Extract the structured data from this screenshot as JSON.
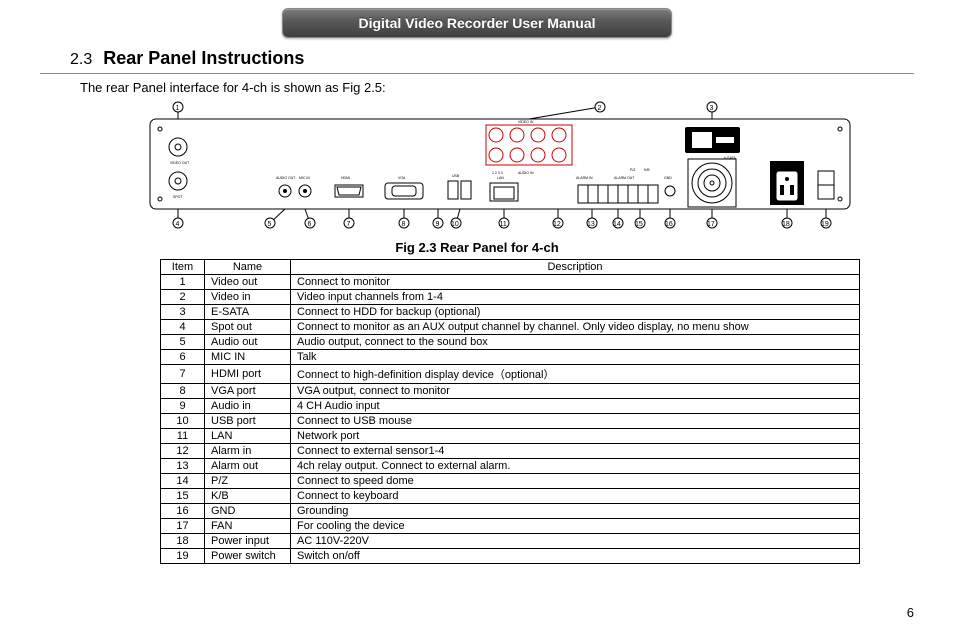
{
  "header": {
    "title": "Digital Video Recorder User Manual"
  },
  "section": {
    "number": "2.3",
    "title": "Rear Panel Instructions",
    "intro": "The rear Panel interface for 4-ch is shown as Fig 2.5:"
  },
  "figure": {
    "caption": "Fig 2.3 Rear Panel for 4-ch"
  },
  "table": {
    "headers": {
      "item": "Item",
      "name": "Name",
      "desc": "Description"
    },
    "rows": [
      {
        "item": "1",
        "name": "Video out",
        "desc": "Connect to monitor"
      },
      {
        "item": "2",
        "name": "Video in",
        "desc": "Video input channels from 1-4"
      },
      {
        "item": "3",
        "name": "E-SATA",
        "desc": "Connect to HDD for backup (optional)"
      },
      {
        "item": "4",
        "name": "Spot out",
        "desc": "Connect to monitor as an AUX output channel by channel. Only video display, no menu show"
      },
      {
        "item": "5",
        "name": "Audio out",
        "desc": "Audio output, connect to the sound box"
      },
      {
        "item": "6",
        "name": "MIC IN",
        "desc": "Talk"
      },
      {
        "item": "7",
        "name": "HDMI port",
        "desc": "Connect to high-definition display device（optional）"
      },
      {
        "item": "8",
        "name": "VGA port",
        "desc": "VGA output, connect to monitor"
      },
      {
        "item": "9",
        "name": "Audio in",
        "desc": "4 CH Audio input"
      },
      {
        "item": "10",
        "name": "USB port",
        "desc": "Connect to USB mouse"
      },
      {
        "item": "11",
        "name": "LAN",
        "desc": "Network port"
      },
      {
        "item": "12",
        "name": "Alarm in",
        "desc": "Connect to external sensor1-4"
      },
      {
        "item": "13",
        "name": "Alarm out",
        "desc": "4ch relay output. Connect to external alarm."
      },
      {
        "item": "14",
        "name": "P/Z",
        "desc": "Connect to speed dome"
      },
      {
        "item": "15",
        "name": "K/B",
        "desc": "Connect to keyboard"
      },
      {
        "item": "16",
        "name": "GND",
        "desc": "Grounding"
      },
      {
        "item": "17",
        "name": "FAN",
        "desc": "For cooling the device"
      },
      {
        "item": "18",
        "name": "Power input",
        "desc": "AC 110V-220V"
      },
      {
        "item": "19",
        "name": "Power switch",
        "desc": "Switch on/off"
      }
    ]
  },
  "diagram": {
    "labels": {
      "video_out": "VIDEO OUT",
      "video_in": "VIDEO IN",
      "spot": "SPOT",
      "audio_out": "AUDIO OUT",
      "mic_in": "MIC IN",
      "hdmi": "HDMI",
      "vga": "VGA",
      "audio_in": "AUDIO IN",
      "usb": "USB",
      "lan": "LAN",
      "alarm_in": "ALARM IN",
      "alarm_out": "ALARM OUT",
      "pz": "P/Z",
      "kb": "K/B",
      "gnd": "GND",
      "esata": "e-SATA",
      "nums": "1 2 3 4"
    },
    "callouts": [
      "1",
      "2",
      "3",
      "4",
      "5",
      "6",
      "7",
      "8",
      "9",
      "10",
      "11",
      "12",
      "13",
      "14",
      "15",
      "16",
      "17",
      "18",
      "19"
    ]
  },
  "page_number": "6"
}
